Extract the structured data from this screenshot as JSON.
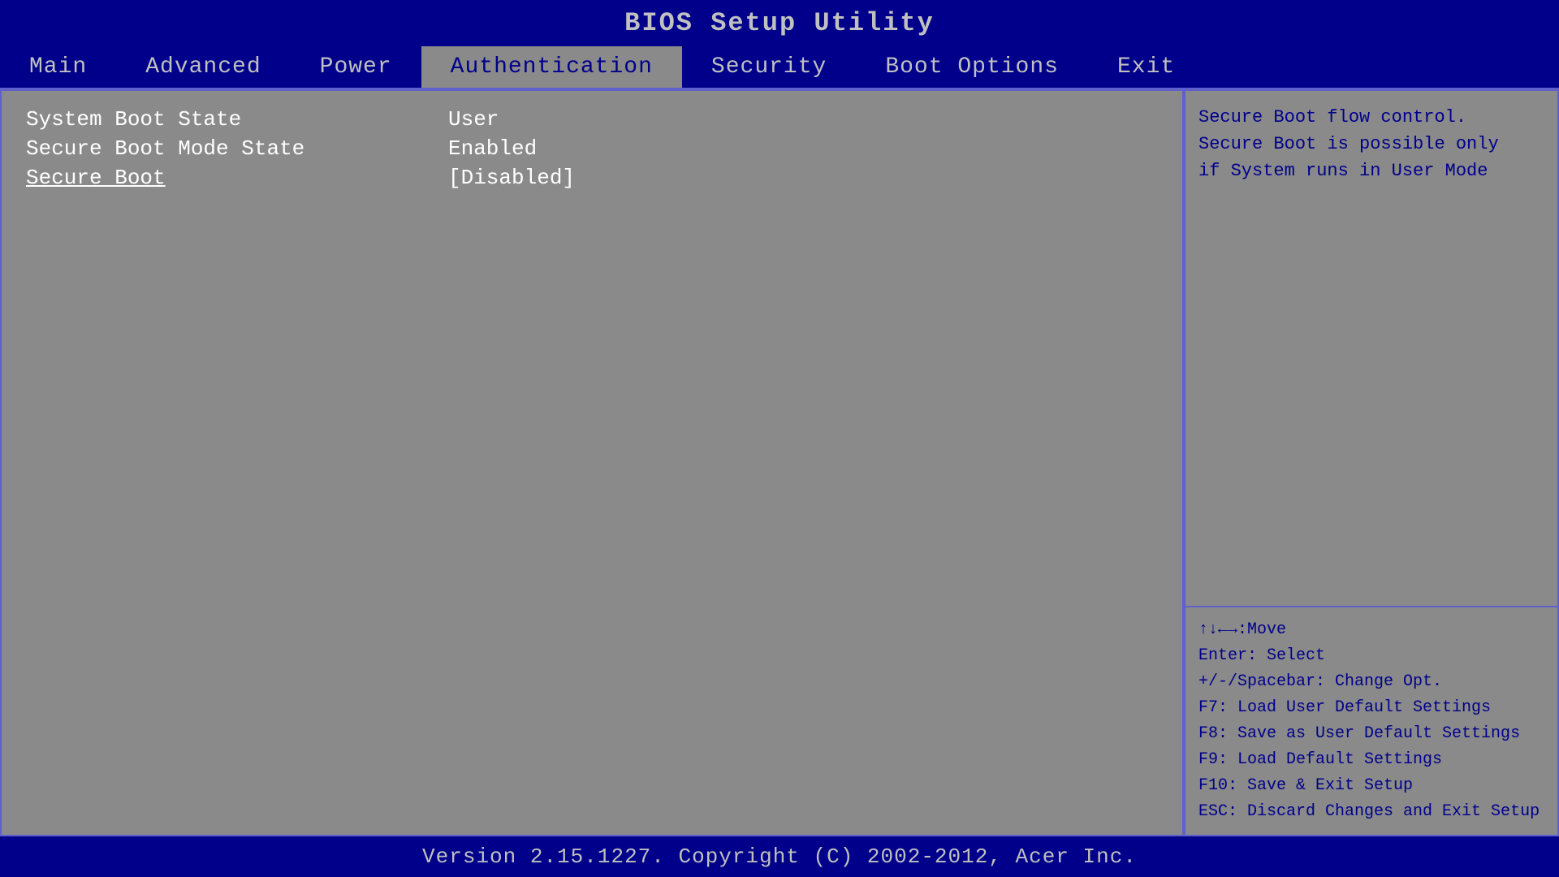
{
  "title": "BIOS Setup Utility",
  "nav": {
    "items": [
      {
        "label": "Main",
        "active": false
      },
      {
        "label": "Advanced",
        "active": false
      },
      {
        "label": "Power",
        "active": false
      },
      {
        "label": "Authentication",
        "active": true
      },
      {
        "label": "Security",
        "active": false
      },
      {
        "label": "Boot Options",
        "active": false
      },
      {
        "label": "Exit",
        "active": false
      }
    ]
  },
  "settings": [
    {
      "label": "System Boot State",
      "value": "User",
      "bracketed": false,
      "highlighted": false
    },
    {
      "label": "Secure Boot Mode State",
      "value": "Enabled",
      "bracketed": false,
      "highlighted": false
    },
    {
      "label": "Secure Boot",
      "value": "[Disabled]",
      "bracketed": true,
      "highlighted": true
    }
  ],
  "help": {
    "text": "Secure Boot flow control.\nSecure Boot is possible only\nif System runs in User Mode"
  },
  "keys": {
    "move": "↑↓←→:Move",
    "enter": "Enter: Select",
    "change": "+/-/Spacebar: Change Opt.",
    "f7": "F7: Load User Default Settings",
    "f8": "F8: Save as User Default Settings",
    "f9": "F9: Load Default Settings",
    "f10": "F10: Save & Exit Setup",
    "esc": "ESC: Discard Changes and Exit Setup"
  },
  "footer": "Version 2.15.1227. Copyright (C) 2002-2012, Acer Inc."
}
